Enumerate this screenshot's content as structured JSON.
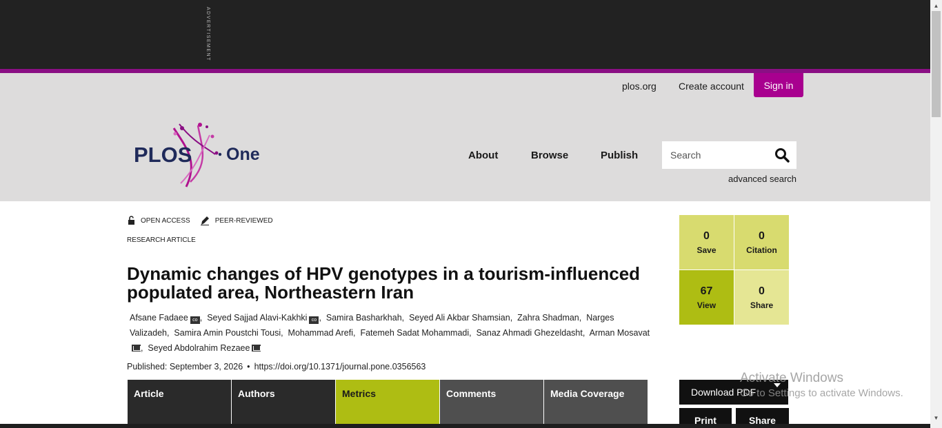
{
  "ad": {
    "label": "ADVERTISEMENT"
  },
  "utility": {
    "plos_org": "plos.org",
    "create_account": "Create account",
    "sign_in": "Sign in"
  },
  "logo": {
    "left": "PLOS",
    "right": "One"
  },
  "nav": {
    "about": "About",
    "browse": "Browse",
    "publish": "Publish"
  },
  "search": {
    "placeholder": "Search",
    "advanced": "advanced search"
  },
  "badges": {
    "open_access": "OPEN ACCESS",
    "peer_reviewed": "PEER-REVIEWED"
  },
  "article": {
    "type": "RESEARCH ARTICLE",
    "title": "Dynamic changes of HPV genotypes in a tourism-influenced populated area, Northeastern Iran",
    "authors": [
      {
        "name": "Afsane Fadaee",
        "badge": "orcid"
      },
      {
        "name": "Seyed Sajjad Alavi-Kakhki",
        "badge": "orcid"
      },
      {
        "name": "Samira Basharkhah",
        "badge": ""
      },
      {
        "name": "Seyed Ali Akbar Shamsian",
        "badge": ""
      },
      {
        "name": "Zahra Shadman",
        "badge": ""
      },
      {
        "name": "Narges Valizadeh",
        "badge": ""
      },
      {
        "name": "Samira Amin Poustchi Tousi",
        "badge": ""
      },
      {
        "name": "Mohammad Arefi",
        "badge": ""
      },
      {
        "name": "Fatemeh Sadat Mohammadi",
        "badge": ""
      },
      {
        "name": "Sanaz Ahmadi Ghezeldasht",
        "badge": ""
      },
      {
        "name": "Arman Mosavat",
        "badge": "mail"
      },
      {
        "name": "Seyed Abdolrahim Rezaee",
        "badge": "mail"
      }
    ],
    "published": "Published: September 3, 2026",
    "doi": "https://doi.org/10.1371/journal.pone.0356563"
  },
  "tabs": [
    "Article",
    "Authors",
    "Metrics",
    "Comments",
    "Media Coverage"
  ],
  "metrics": {
    "save": {
      "value": "0",
      "label": "Save"
    },
    "citation": {
      "value": "0",
      "label": "Citation"
    },
    "view": {
      "value": "67",
      "label": "View"
    },
    "share": {
      "value": "0",
      "label": "Share"
    }
  },
  "actions": {
    "download_pdf": "Download PDF",
    "print": "Print",
    "share": "Share"
  },
  "watermark": {
    "line1": "Activate Windows",
    "line2": "Go to Settings to activate Windows."
  },
  "colors": {
    "accent": "#a8008f",
    "tab_active": "#aebd13",
    "header_bg": "#dddcdc"
  }
}
